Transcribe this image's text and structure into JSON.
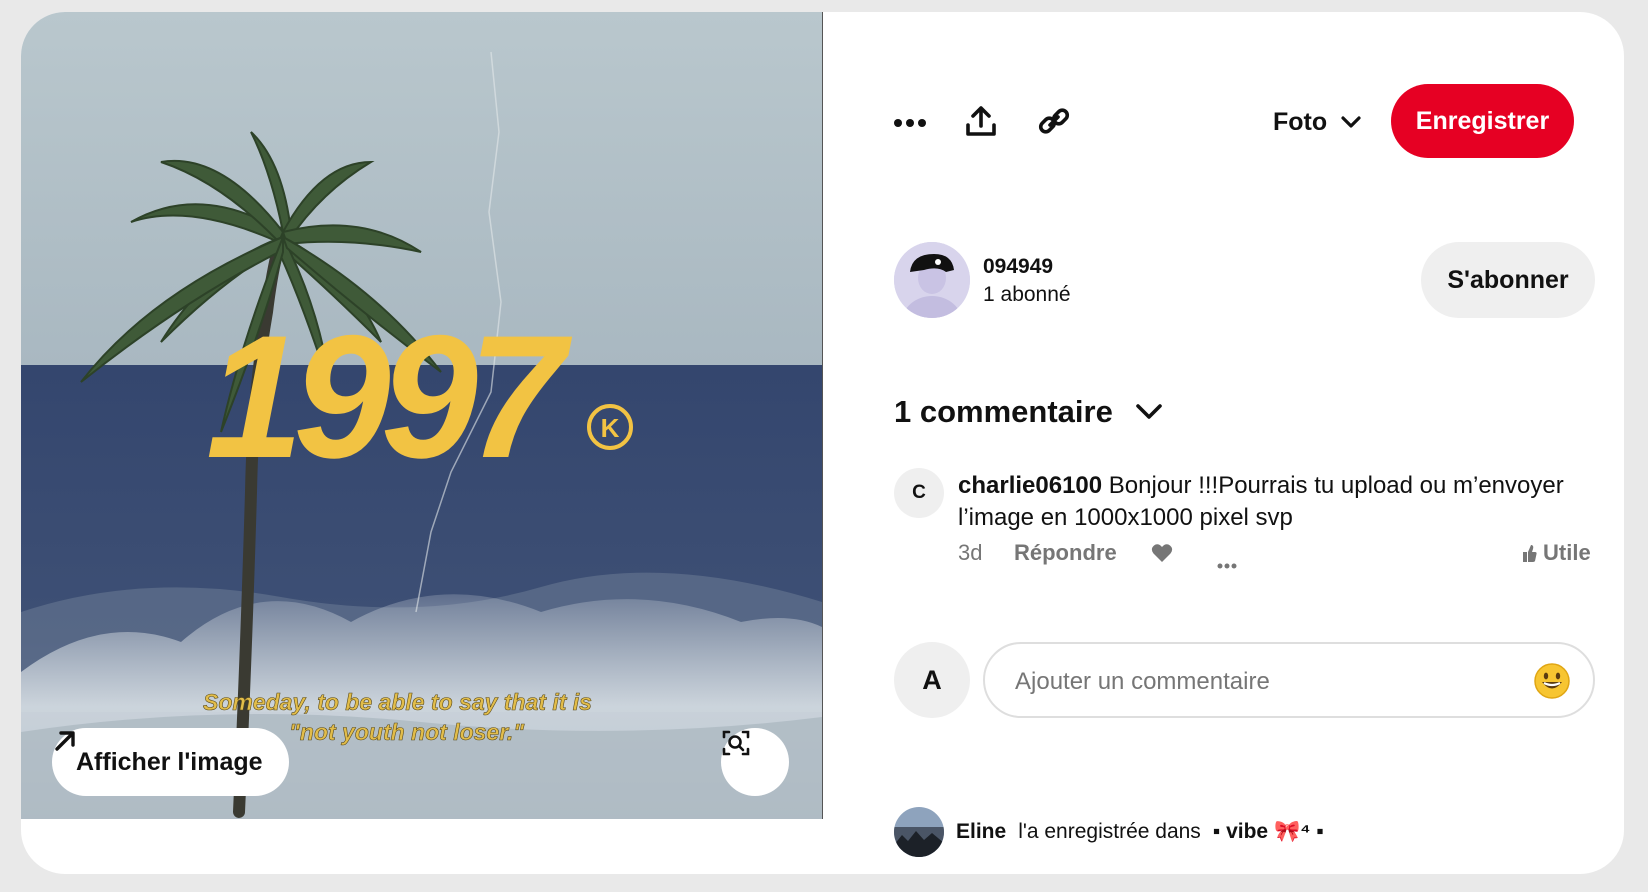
{
  "toolbar": {
    "more_icon": "ellipsis-icon",
    "share_icon": "share-upload-icon",
    "link_icon": "link-icon",
    "media_type": "Foto",
    "save_label": "Enregistrer"
  },
  "image": {
    "overlay_big_text": "1997",
    "overlay_k": "K",
    "caption_line1": "Someday, to be able to say that it is",
    "caption_line2": "\"not youth not loser.\"",
    "view_image_label": "Afficher l'image",
    "visual_search_icon": "lens-search-icon"
  },
  "creator": {
    "name": "094949",
    "followers": "1 abonné",
    "follow_label": "S'abonner"
  },
  "comments": {
    "header": "1 commentaire",
    "items": [
      {
        "initial": "C",
        "author": "charlie06100",
        "text": "Bonjour !!!Pourrais tu upload ou m’envoyer l’image en 1000x1000 pixel svp",
        "age": "3d",
        "reply_label": "Répondre",
        "useful_label": "Utile"
      }
    ]
  },
  "composer": {
    "initial": "A",
    "placeholder": "Ajouter un commentaire"
  },
  "saved": {
    "user": "Eline",
    "action": "l'a enregistrée dans",
    "board": "▪ vibe 🎀⁴ ▪"
  },
  "colors": {
    "accent": "#e60023",
    "image_text_yellow": "#f2c343"
  }
}
